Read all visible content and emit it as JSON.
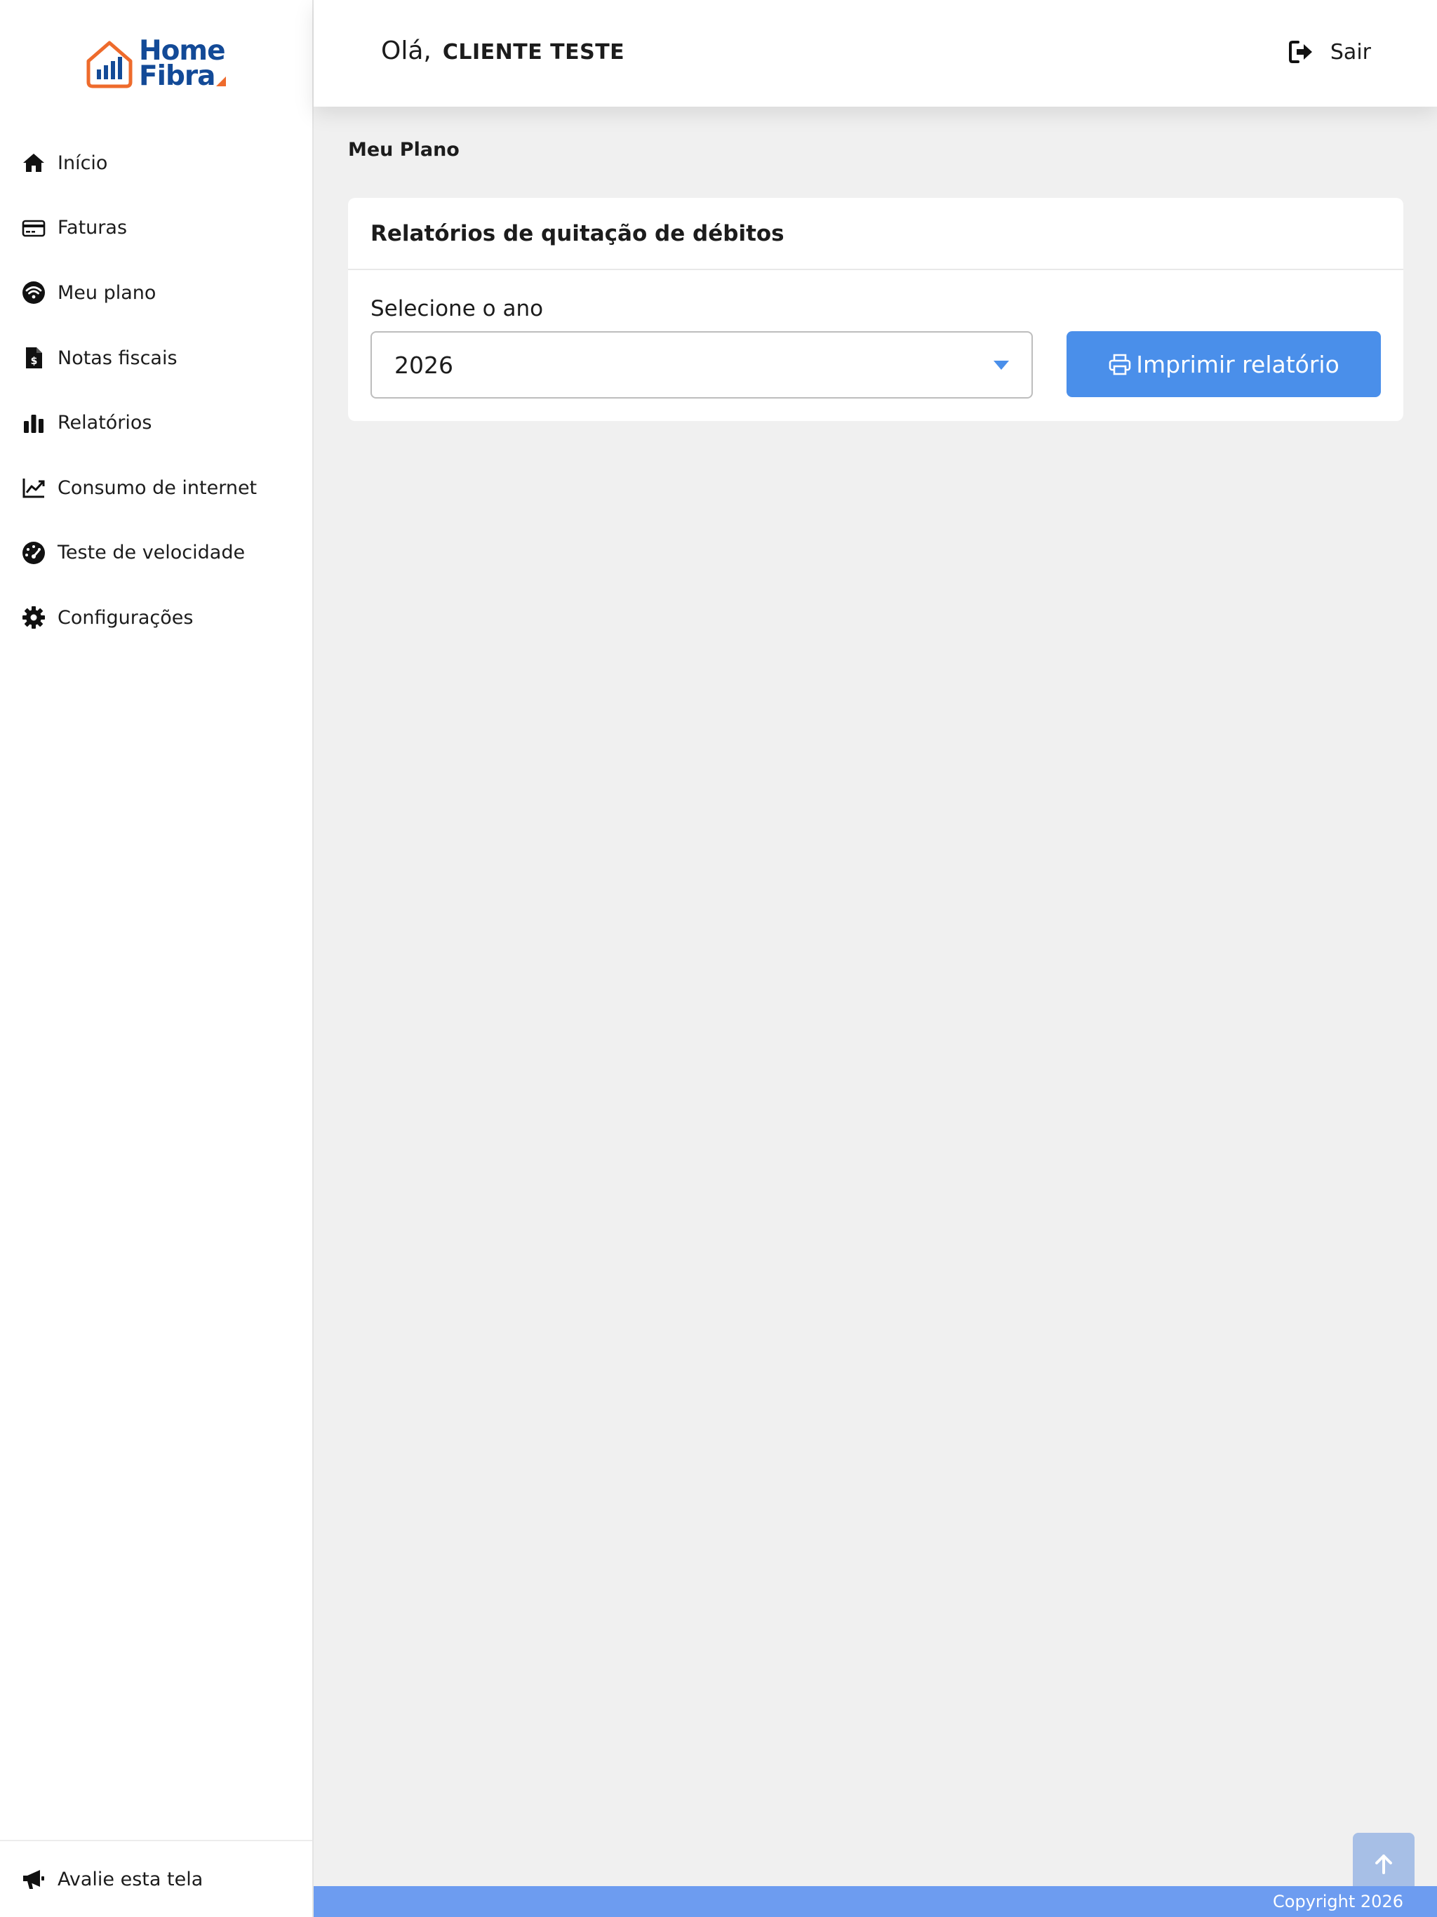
{
  "brand": {
    "line1": "Home",
    "line2": "Fibra",
    "primary_color": "#134a97",
    "accent_color": "#ee6b2c"
  },
  "sidebar": {
    "items": [
      {
        "label": "Início",
        "icon": "home-icon"
      },
      {
        "label": "Faturas",
        "icon": "credit-card-icon"
      },
      {
        "label": "Meu plano",
        "icon": "wifi-icon"
      },
      {
        "label": "Notas fiscais",
        "icon": "invoice-dollar-icon"
      },
      {
        "label": "Relatórios",
        "icon": "bar-chart-icon"
      },
      {
        "label": "Consumo de internet",
        "icon": "line-chart-icon"
      },
      {
        "label": "Teste de velocidade",
        "icon": "speedometer-icon"
      },
      {
        "label": "Configurações",
        "icon": "gear-icon"
      }
    ],
    "footer": {
      "label": "Avalie esta tela",
      "icon": "megaphone-icon"
    }
  },
  "header": {
    "greeting": "Olá,",
    "client_name": "CLIENTE TESTE",
    "logout_label": "Sair"
  },
  "main": {
    "page_title": "Meu Plano",
    "card": {
      "title": "Relatórios de quitação de débitos",
      "select_label": "Selecione o ano",
      "selected_year": "2026",
      "print_button": "Imprimir relatório"
    }
  },
  "footer": {
    "copyright": "Copyright 2026"
  },
  "colors": {
    "button_blue": "#4a8fea",
    "footer_blue": "#6d9cf0",
    "page_bg": "#f0f0f0"
  }
}
